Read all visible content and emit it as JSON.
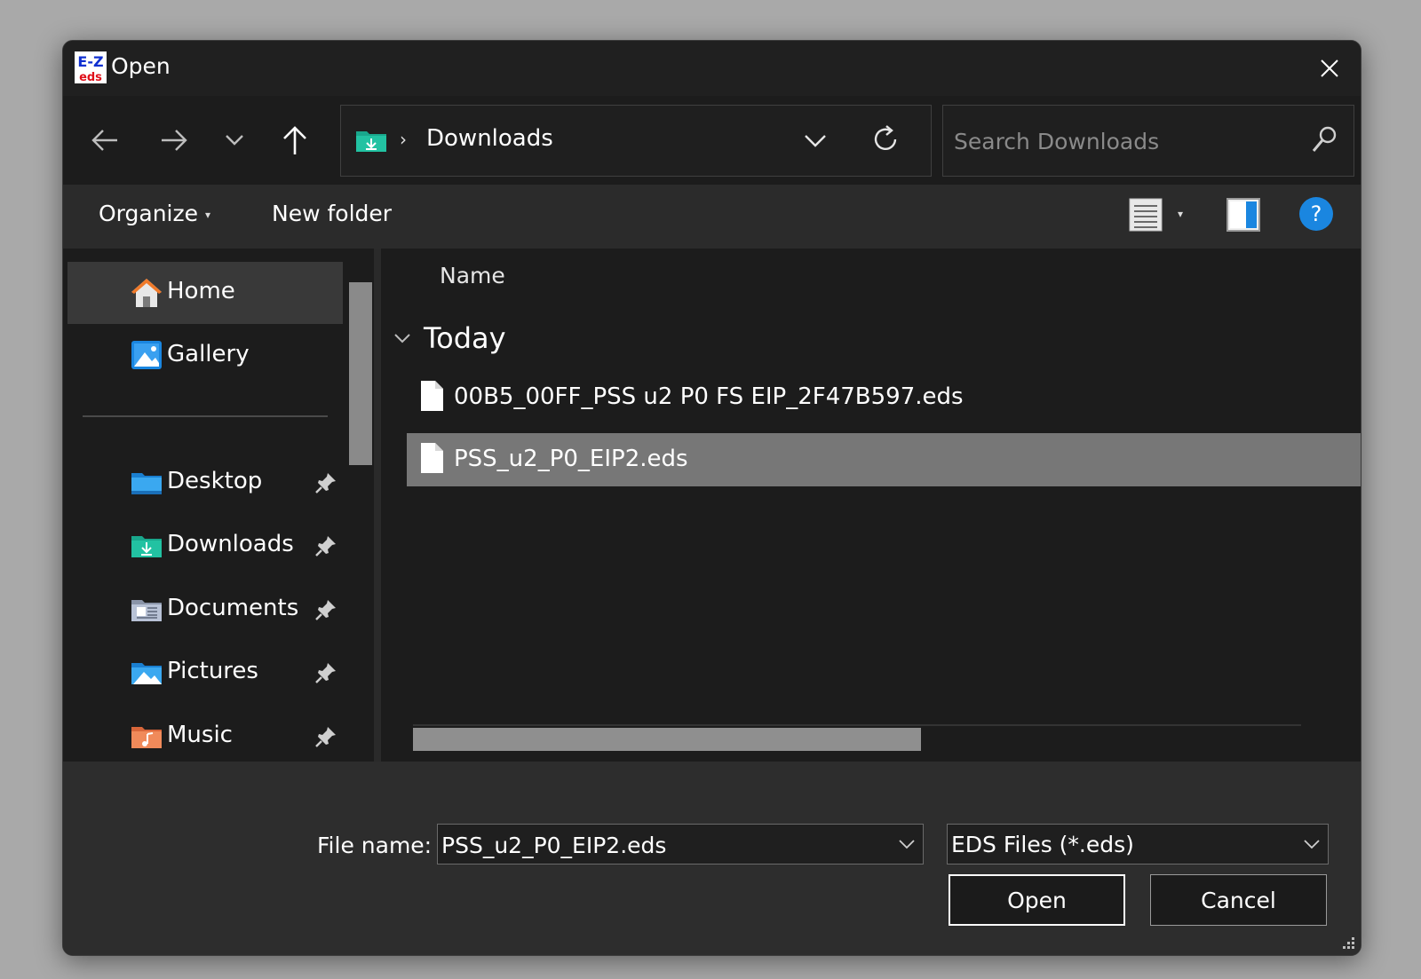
{
  "window": {
    "title": "Open",
    "app_icon": "ez-eds-app-icon",
    "app_icon_text_top": "E-Z",
    "app_icon_text_bottom": "eds"
  },
  "address_bar": {
    "folder_icon": "downloads-folder-icon",
    "path": "Downloads"
  },
  "search": {
    "placeholder": "Search Downloads"
  },
  "command_bar": {
    "organize_label": "Organize",
    "new_folder_label": "New folder"
  },
  "nav_pane": {
    "items": [
      {
        "label": "Home",
        "icon": "home-icon",
        "selected": true,
        "pinned": false
      },
      {
        "label": "Gallery",
        "icon": "gallery-icon",
        "selected": false,
        "pinned": false
      },
      {
        "label": "Desktop",
        "icon": "desktop-folder-icon",
        "selected": false,
        "pinned": true
      },
      {
        "label": "Downloads",
        "icon": "downloads-folder-icon",
        "selected": false,
        "pinned": true
      },
      {
        "label": "Documents",
        "icon": "documents-folder-icon",
        "selected": false,
        "pinned": true
      },
      {
        "label": "Pictures",
        "icon": "pictures-folder-icon",
        "selected": false,
        "pinned": true
      },
      {
        "label": "Music",
        "icon": "music-folder-icon",
        "selected": false,
        "pinned": true
      }
    ]
  },
  "file_list": {
    "column_header": "Name",
    "group": "Today",
    "files": [
      {
        "name": "00B5_00FF_PSS u2 P0 FS EIP_2F47B597.eds",
        "selected": false
      },
      {
        "name": "PSS_u2_P0_EIP2.eds",
        "selected": true
      }
    ]
  },
  "footer": {
    "file_name_label": "File name:",
    "file_name_value": "PSS_u2_P0_EIP2.eds",
    "file_type": "EDS Files (*.eds)",
    "open_label": "Open",
    "cancel_label": "Cancel"
  },
  "colors": {
    "accent": "#1a86e0",
    "selection": "#777777",
    "background": "#1c1c1c"
  }
}
